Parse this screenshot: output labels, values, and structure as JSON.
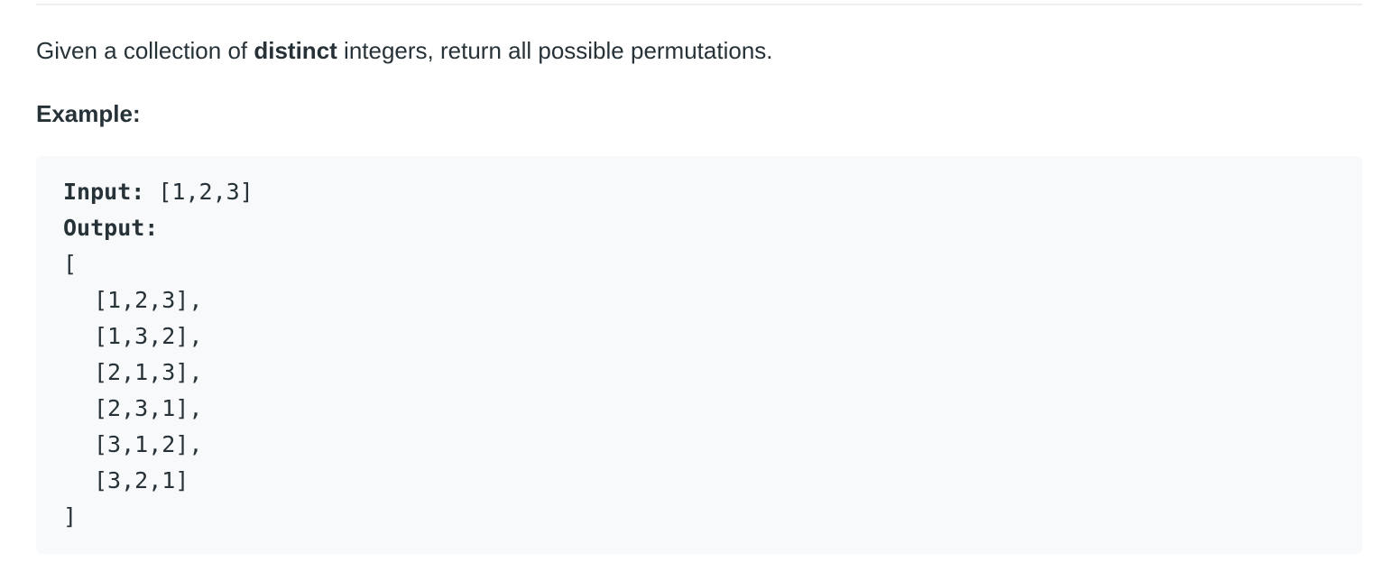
{
  "description": {
    "before": "Given a collection of ",
    "emphasis": "distinct",
    "after": " integers, return all possible permutations."
  },
  "example": {
    "heading": "Example:",
    "input_label": "Input:",
    "input_value": " [1,2,3]",
    "output_label": "Output:",
    "open_bracket": "[",
    "permutations": [
      "[1,2,3],",
      "[1,3,2],",
      "[2,1,3],",
      "[2,3,1],",
      "[3,1,2],",
      "[3,2,1]"
    ],
    "close_bracket": "]"
  }
}
